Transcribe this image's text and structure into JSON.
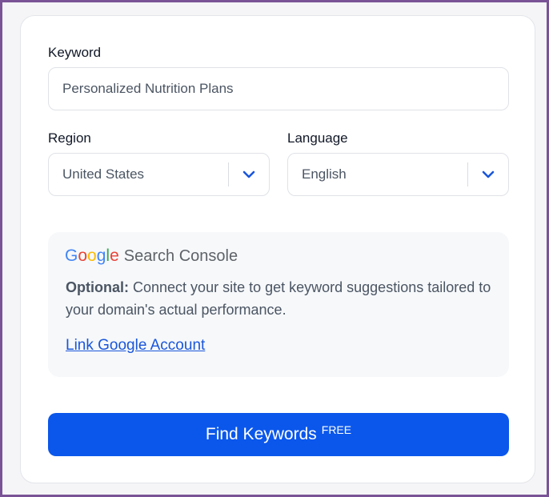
{
  "form": {
    "keyword_label": "Keyword",
    "keyword_value": "Personalized Nutrition Plans",
    "region_label": "Region",
    "region_value": "United States",
    "language_label": "Language",
    "language_value": "English"
  },
  "gsc": {
    "logo_google": [
      "G",
      "o",
      "o",
      "g",
      "l",
      "e"
    ],
    "logo_google_colors": [
      "#4285F4",
      "#EA4335",
      "#FBBC05",
      "#4285F4",
      "#34A853",
      "#EA4335"
    ],
    "logo_suffix": "Search Console",
    "optional_label": "Optional:",
    "description": "Connect your site to get keyword suggestions tailored to your domain's actual performance.",
    "link_label": "Link Google Account"
  },
  "submit": {
    "label": "Find Keywords",
    "badge": "FREE"
  },
  "colors": {
    "accent": "#0b57eb",
    "link": "#1a56db",
    "frame": "#7a5396"
  },
  "icons": {
    "select_arrow": "chevron-down-icon"
  }
}
